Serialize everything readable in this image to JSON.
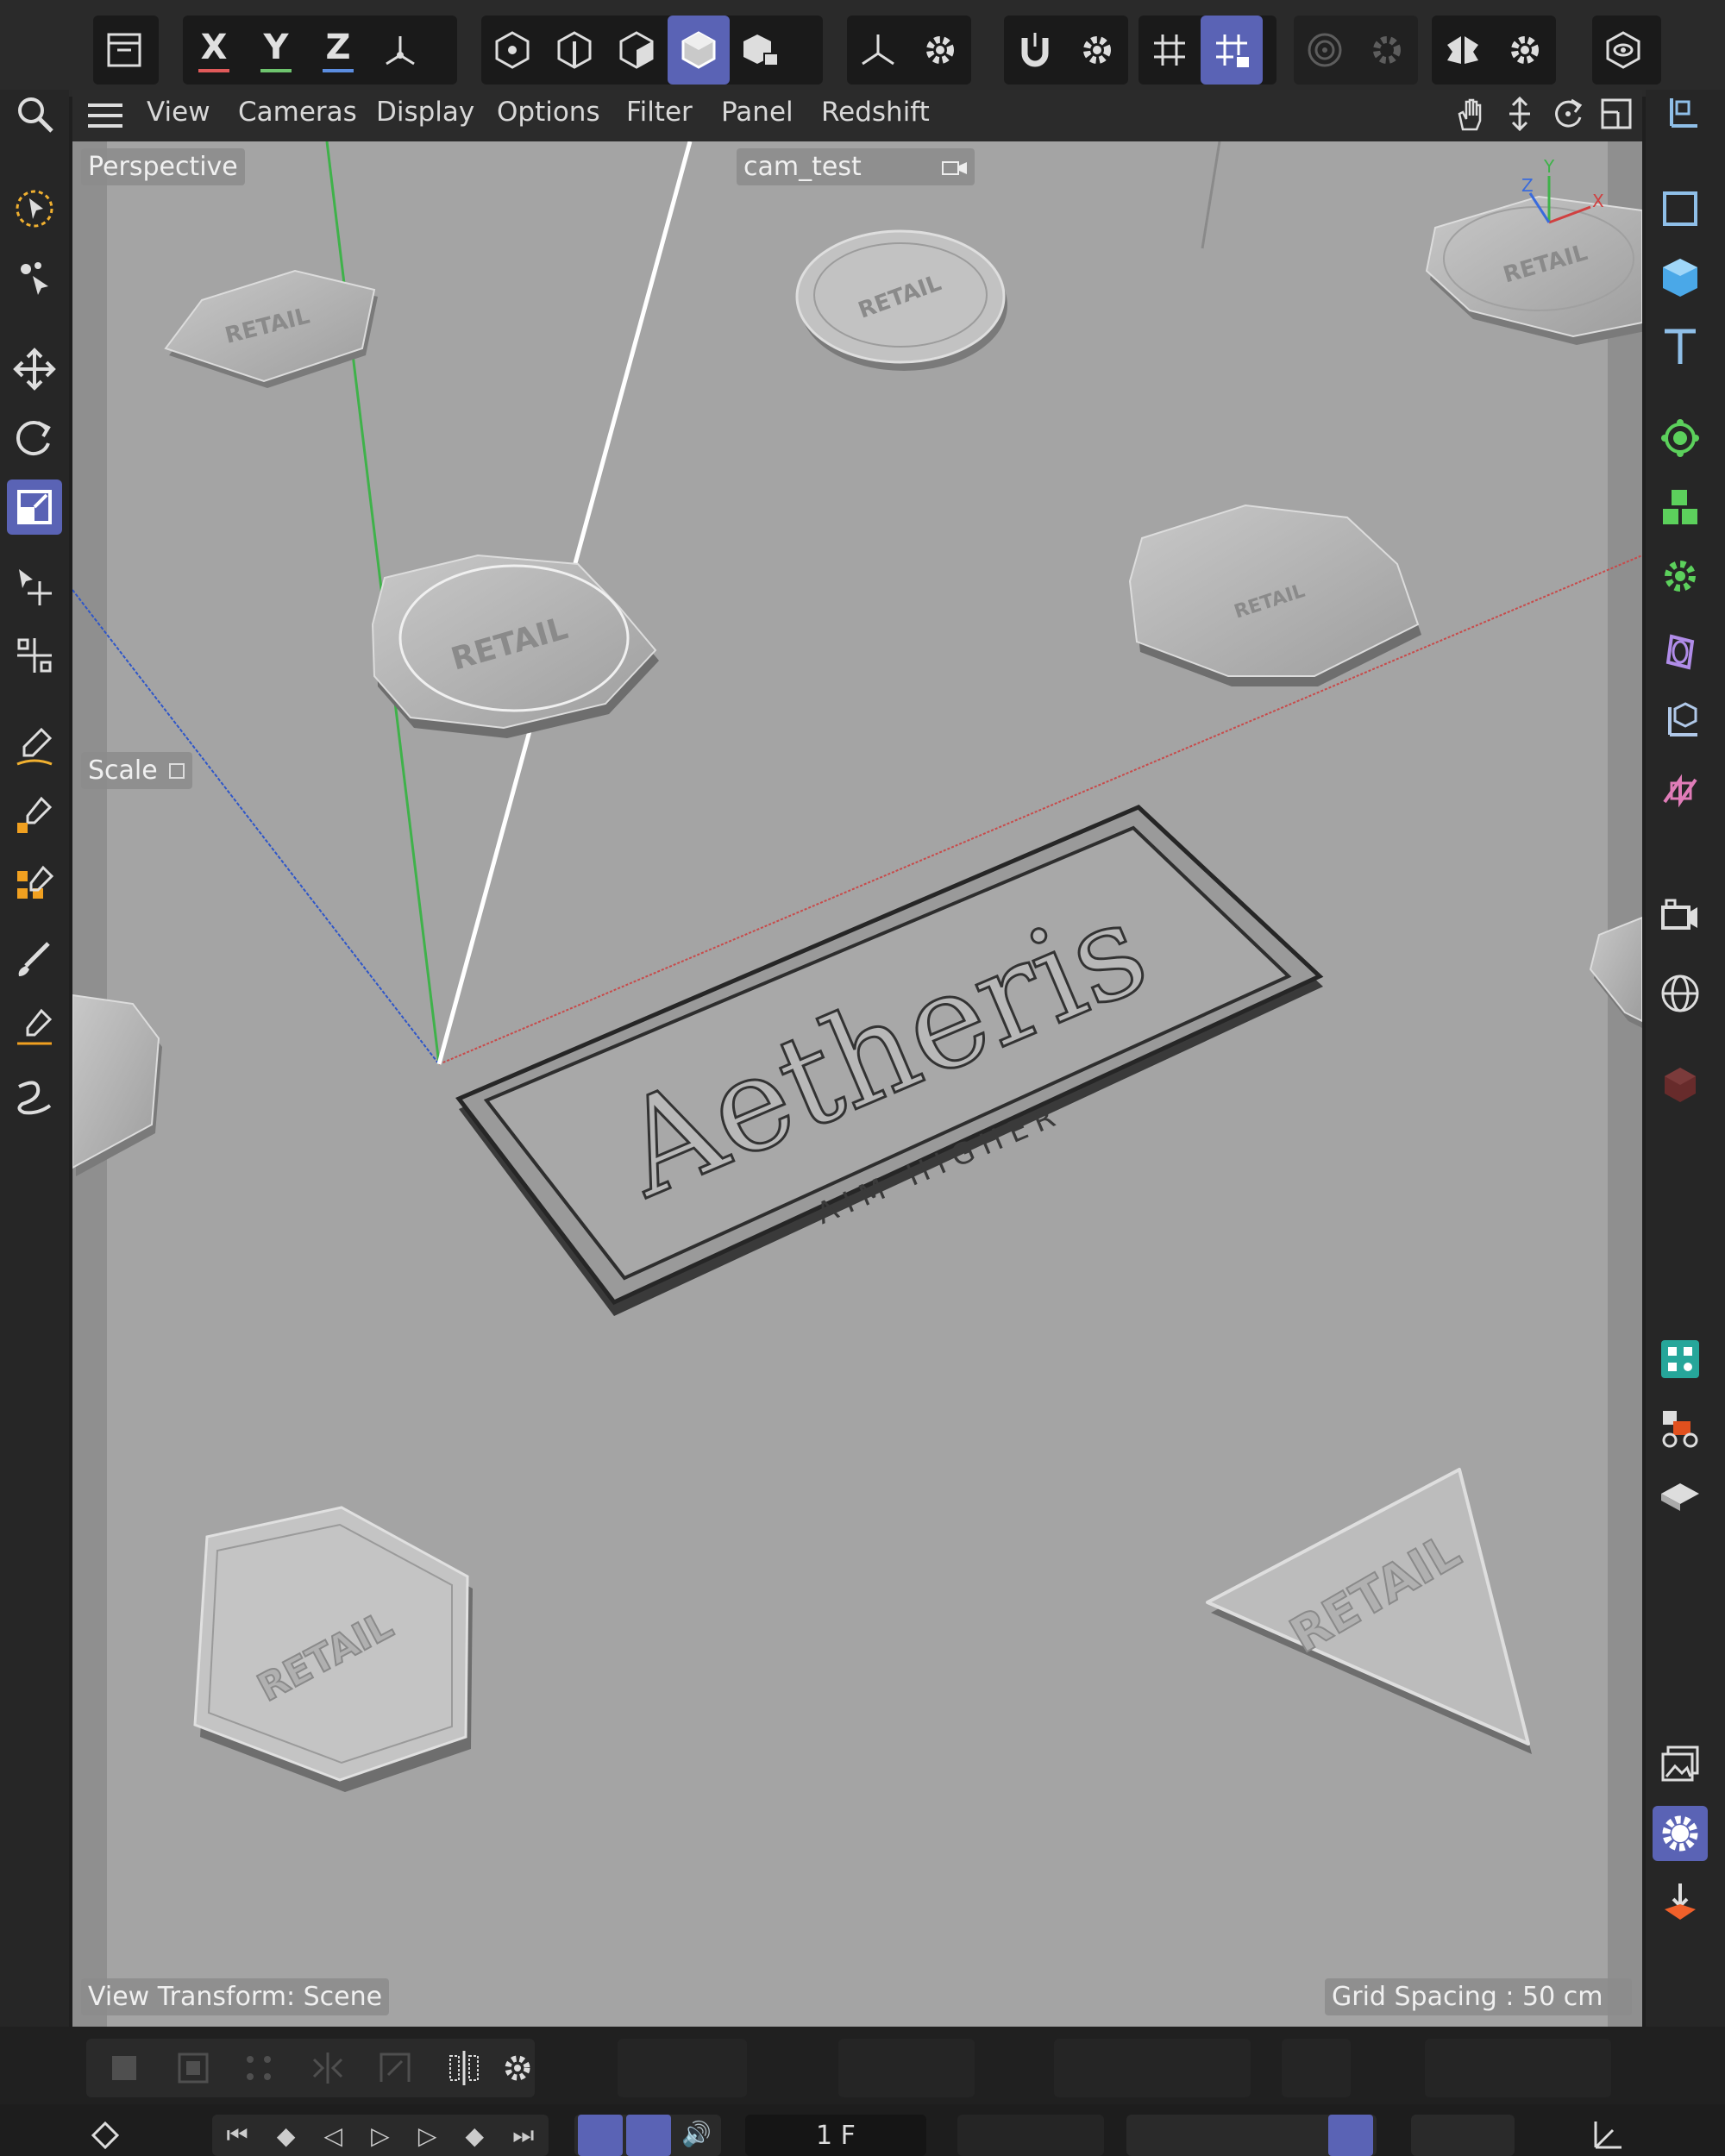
{
  "viewport_menu": {
    "items": [
      "View",
      "Cameras",
      "Display",
      "Options",
      "Filter",
      "Panel",
      "Redshift"
    ]
  },
  "axis_buttons": {
    "x": "X",
    "y": "Y",
    "z": "Z"
  },
  "viewport": {
    "mode_label": "Perspective",
    "camera_label": "cam_test",
    "hud_tool_label": "Scale",
    "view_transform": "View Transform: Scene",
    "grid_spacing": "Grid Spacing : 50 cm",
    "gizmo_axes": {
      "z": "Z",
      "y": "Y",
      "x": "X"
    }
  },
  "scene_text": {
    "brand": "Aetheris",
    "tagline": "AIM HIGHER",
    "badge": "RETAIL"
  },
  "timeline": {
    "frame": "1 F"
  },
  "colors": {
    "accent": "#5a63b5",
    "x_axis": "#e05a5a",
    "y_axis": "#6ec46e",
    "z_axis": "#5b8de0",
    "viewport_bg": "#a4a4a4",
    "panel_bg": "#262626"
  }
}
